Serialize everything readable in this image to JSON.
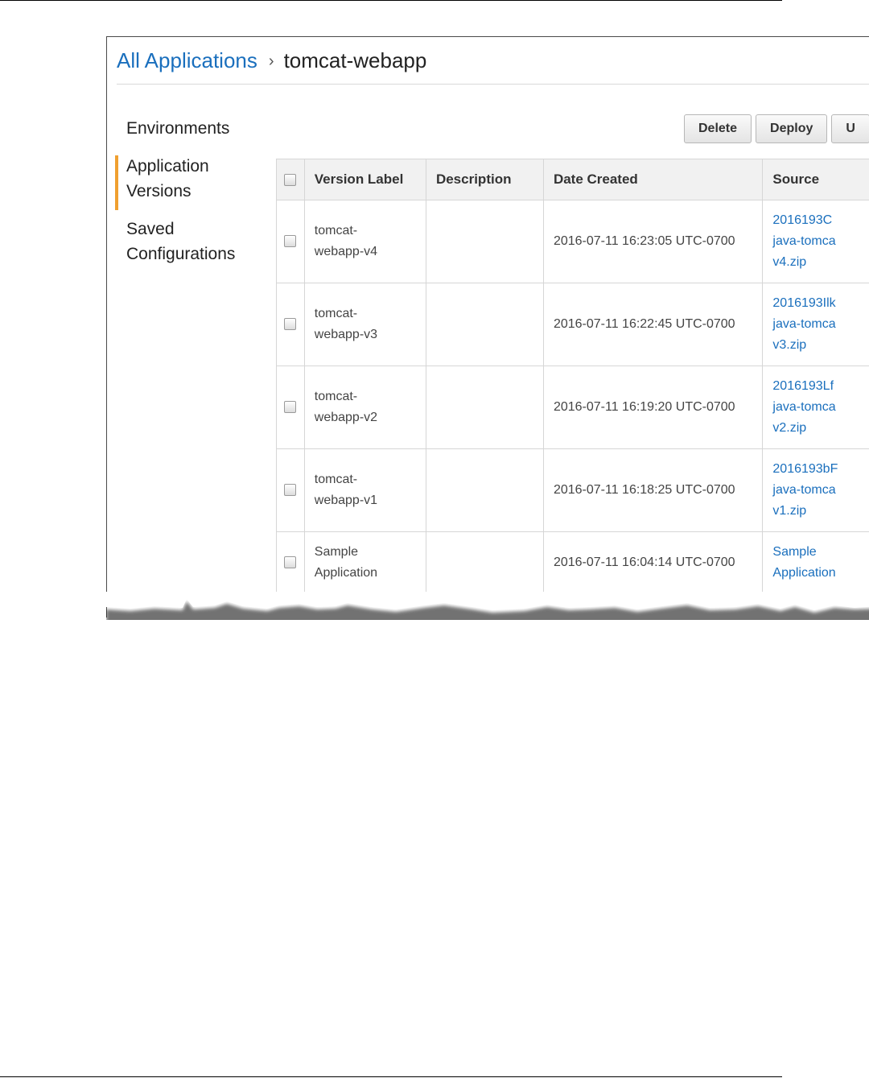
{
  "breadcrumb": {
    "root": "All Applications",
    "separator": "›",
    "current": "tomcat-webapp"
  },
  "nav": [
    {
      "label": "Environments",
      "active": false
    },
    {
      "label": "Application Versions",
      "active": true
    },
    {
      "label": "Saved Configurations",
      "active": false
    }
  ],
  "toolbar": {
    "delete_label": "Delete",
    "deploy_label": "Deploy",
    "upload_label": "U"
  },
  "table": {
    "headers": {
      "version_label": "Version Label",
      "description": "Description",
      "date_created": "Date Created",
      "source": "Source"
    },
    "rows": [
      {
        "version_line1": "tomcat-",
        "version_line2": "webapp-v4",
        "description": "",
        "date": "2016-07-11 16:23:05 UTC-0700",
        "source_line1": "2016193C",
        "source_line2": "java-tomca",
        "source_line3": "v4.zip"
      },
      {
        "version_line1": "tomcat-",
        "version_line2": "webapp-v3",
        "description": "",
        "date": "2016-07-11 16:22:45 UTC-0700",
        "source_line1": "2016193Ilk",
        "source_line2": "java-tomca",
        "source_line3": "v3.zip"
      },
      {
        "version_line1": "tomcat-",
        "version_line2": "webapp-v2",
        "description": "",
        "date": "2016-07-11 16:19:20 UTC-0700",
        "source_line1": "2016193Lf",
        "source_line2": "java-tomca",
        "source_line3": "v2.zip"
      },
      {
        "version_line1": "tomcat-",
        "version_line2": "webapp-v1",
        "description": "",
        "date": "2016-07-11 16:18:25 UTC-0700",
        "source_line1": "2016193bF",
        "source_line2": "java-tomca",
        "source_line3": "v1.zip"
      },
      {
        "version_line1": "Sample",
        "version_line2": "Application",
        "description": "",
        "date": "2016-07-11 16:04:14 UTC-0700",
        "source_line1": "Sample",
        "source_line2": "Application",
        "source_line3": ""
      }
    ]
  },
  "colors": {
    "link": "#1a6fbd",
    "active_nav_accent": "#f0a030",
    "header_bg": "#f1f1f1"
  }
}
